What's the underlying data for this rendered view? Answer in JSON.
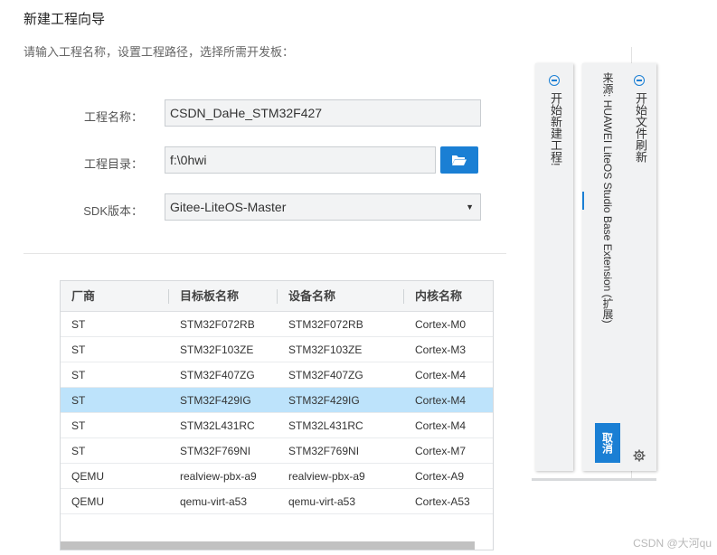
{
  "wizard": {
    "title": "新建工程向导",
    "subtitle": "请输入工程名称，设置工程路径，选择所需开发板："
  },
  "form": {
    "project_name_label": "工程名称：",
    "project_name_value": "CSDN_DaHe_STM32F427",
    "project_dir_label": "工程目录：",
    "project_dir_value": "f:\\0hwi",
    "sdk_label": "SDK版本：",
    "sdk_value": "Gitee-LiteOS-Master"
  },
  "table": {
    "columns": [
      "厂商",
      "目标板名称",
      "设备名称",
      "内核名称"
    ],
    "selected_index": 3,
    "rows": [
      {
        "vendor": "ST",
        "board": "STM32F072RB",
        "device": "STM32F072RB",
        "core": "Cortex-M0"
      },
      {
        "vendor": "ST",
        "board": "STM32F103ZE",
        "device": "STM32F103ZE",
        "core": "Cortex-M3"
      },
      {
        "vendor": "ST",
        "board": "STM32F407ZG",
        "device": "STM32F407ZG",
        "core": "Cortex-M4"
      },
      {
        "vendor": "ST",
        "board": "STM32F429IG",
        "device": "STM32F429IG",
        "core": "Cortex-M4"
      },
      {
        "vendor": "ST",
        "board": "STM32L431RC",
        "device": "STM32L431RC",
        "core": "Cortex-M4"
      },
      {
        "vendor": "ST",
        "board": "STM32F769NI",
        "device": "STM32F769NI",
        "core": "Cortex-M7"
      },
      {
        "vendor": "QEMU",
        "board": "realview-pbx-a9",
        "device": "realview-pbx-a9",
        "core": "Cortex-A9"
      },
      {
        "vendor": "QEMU",
        "board": "qemu-virt-a53",
        "device": "qemu-virt-a53",
        "core": "Cortex-A53"
      }
    ]
  },
  "notifications": {
    "panel1_text": "开始新建工程!",
    "panel2_title": "开始文件刷新",
    "panel2_source": "来源: HUAWEI LiteOS Studio Base Extension (扩展)",
    "cancel_label": "取消"
  },
  "watermark": "CSDN @大河qu",
  "colors": {
    "accent": "#1a7fd4",
    "selected_row": "#bde3fb"
  }
}
